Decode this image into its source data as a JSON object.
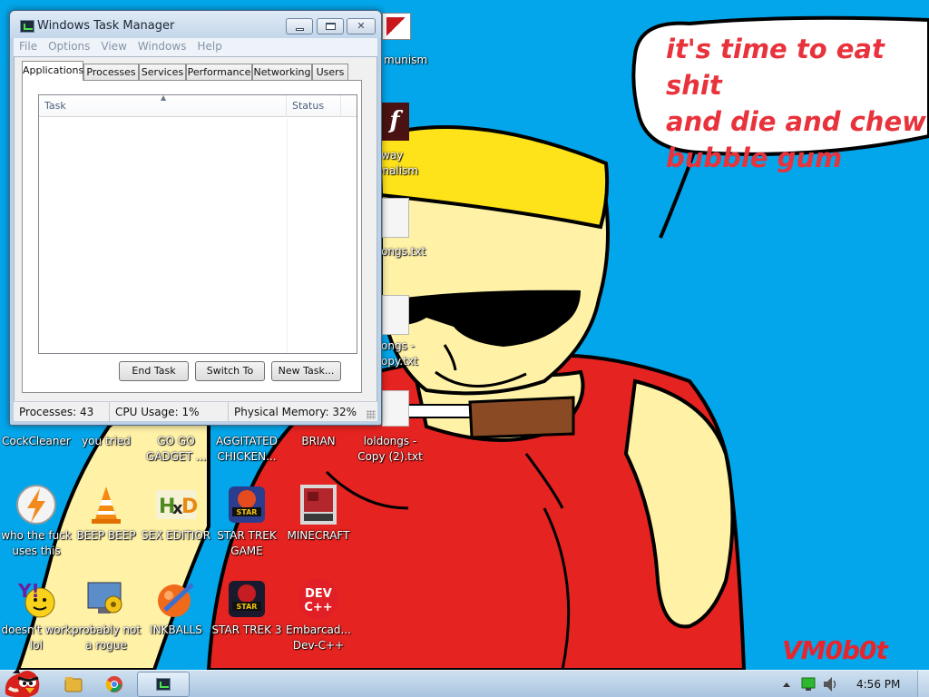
{
  "desktop": {
    "speech_text": "it's time to eat shit\nand die and chew\nbubble gum",
    "signature": "VM0b0t",
    "peek_labels": [
      "munism",
      "way",
      "onalism",
      "ongs.txt",
      "ongs -",
      "opy.txt"
    ],
    "icons": [
      {
        "label": "CockCleaner",
        "icon": "red-app-icon"
      },
      {
        "label": "you tried",
        "icon": "app-icon"
      },
      {
        "label": "GO GO GADGET ...",
        "icon": "app-icon"
      },
      {
        "label": "AGGITATED CHICKEN...",
        "icon": "app-icon"
      },
      {
        "label": "BRIAN",
        "icon": "app-icon"
      },
      {
        "label": "loldongs - Copy (2).txt",
        "icon": "text-file-icon"
      },
      {
        "label": "who the fuck uses this",
        "icon": "lightning-icon"
      },
      {
        "label": "BEEP BEEP",
        "icon": "vlc-cone-icon"
      },
      {
        "label": "SEX EDITIOR",
        "icon": "hxd-editor-icon"
      },
      {
        "label": "STAR TREK GAME",
        "icon": "star-wars-game-icon"
      },
      {
        "label": "MINECRAFT",
        "icon": "minecraft-icon"
      },
      {
        "label": "doesn't work lol",
        "icon": "yahoo-messenger-icon"
      },
      {
        "label": "probably not a rogue",
        "icon": "monitor-gears-icon"
      },
      {
        "label": "INKBALLS",
        "icon": "inkball-icon"
      },
      {
        "label": "STAR TREK 3",
        "icon": "star-wars-game-icon"
      },
      {
        "label": "Embarcad... Dev-C++",
        "icon": "dev-cpp-icon"
      }
    ]
  },
  "task_manager": {
    "title": "Windows Task Manager",
    "menu": [
      "File",
      "Options",
      "View",
      "Windows",
      "Help"
    ],
    "tabs": [
      "Applications",
      "Processes",
      "Services",
      "Performance",
      "Networking",
      "Users"
    ],
    "active_tab": "Applications",
    "columns": [
      "Task",
      "Status"
    ],
    "buttons": {
      "end_task": "End Task",
      "switch_to": "Switch To",
      "new_task": "New Task..."
    },
    "status": {
      "processes": "Processes: 43",
      "cpu": "CPU Usage: 1%",
      "memory": "Physical Memory: 32%"
    }
  },
  "taskbar": {
    "clock": "4:56 PM",
    "pinned": [
      "angry-birds-start-icon",
      "folder-icon",
      "chrome-icon",
      "task-manager-icon"
    ],
    "tray": [
      "tray-arrow-icon",
      "network-icon",
      "volume-icon"
    ]
  }
}
